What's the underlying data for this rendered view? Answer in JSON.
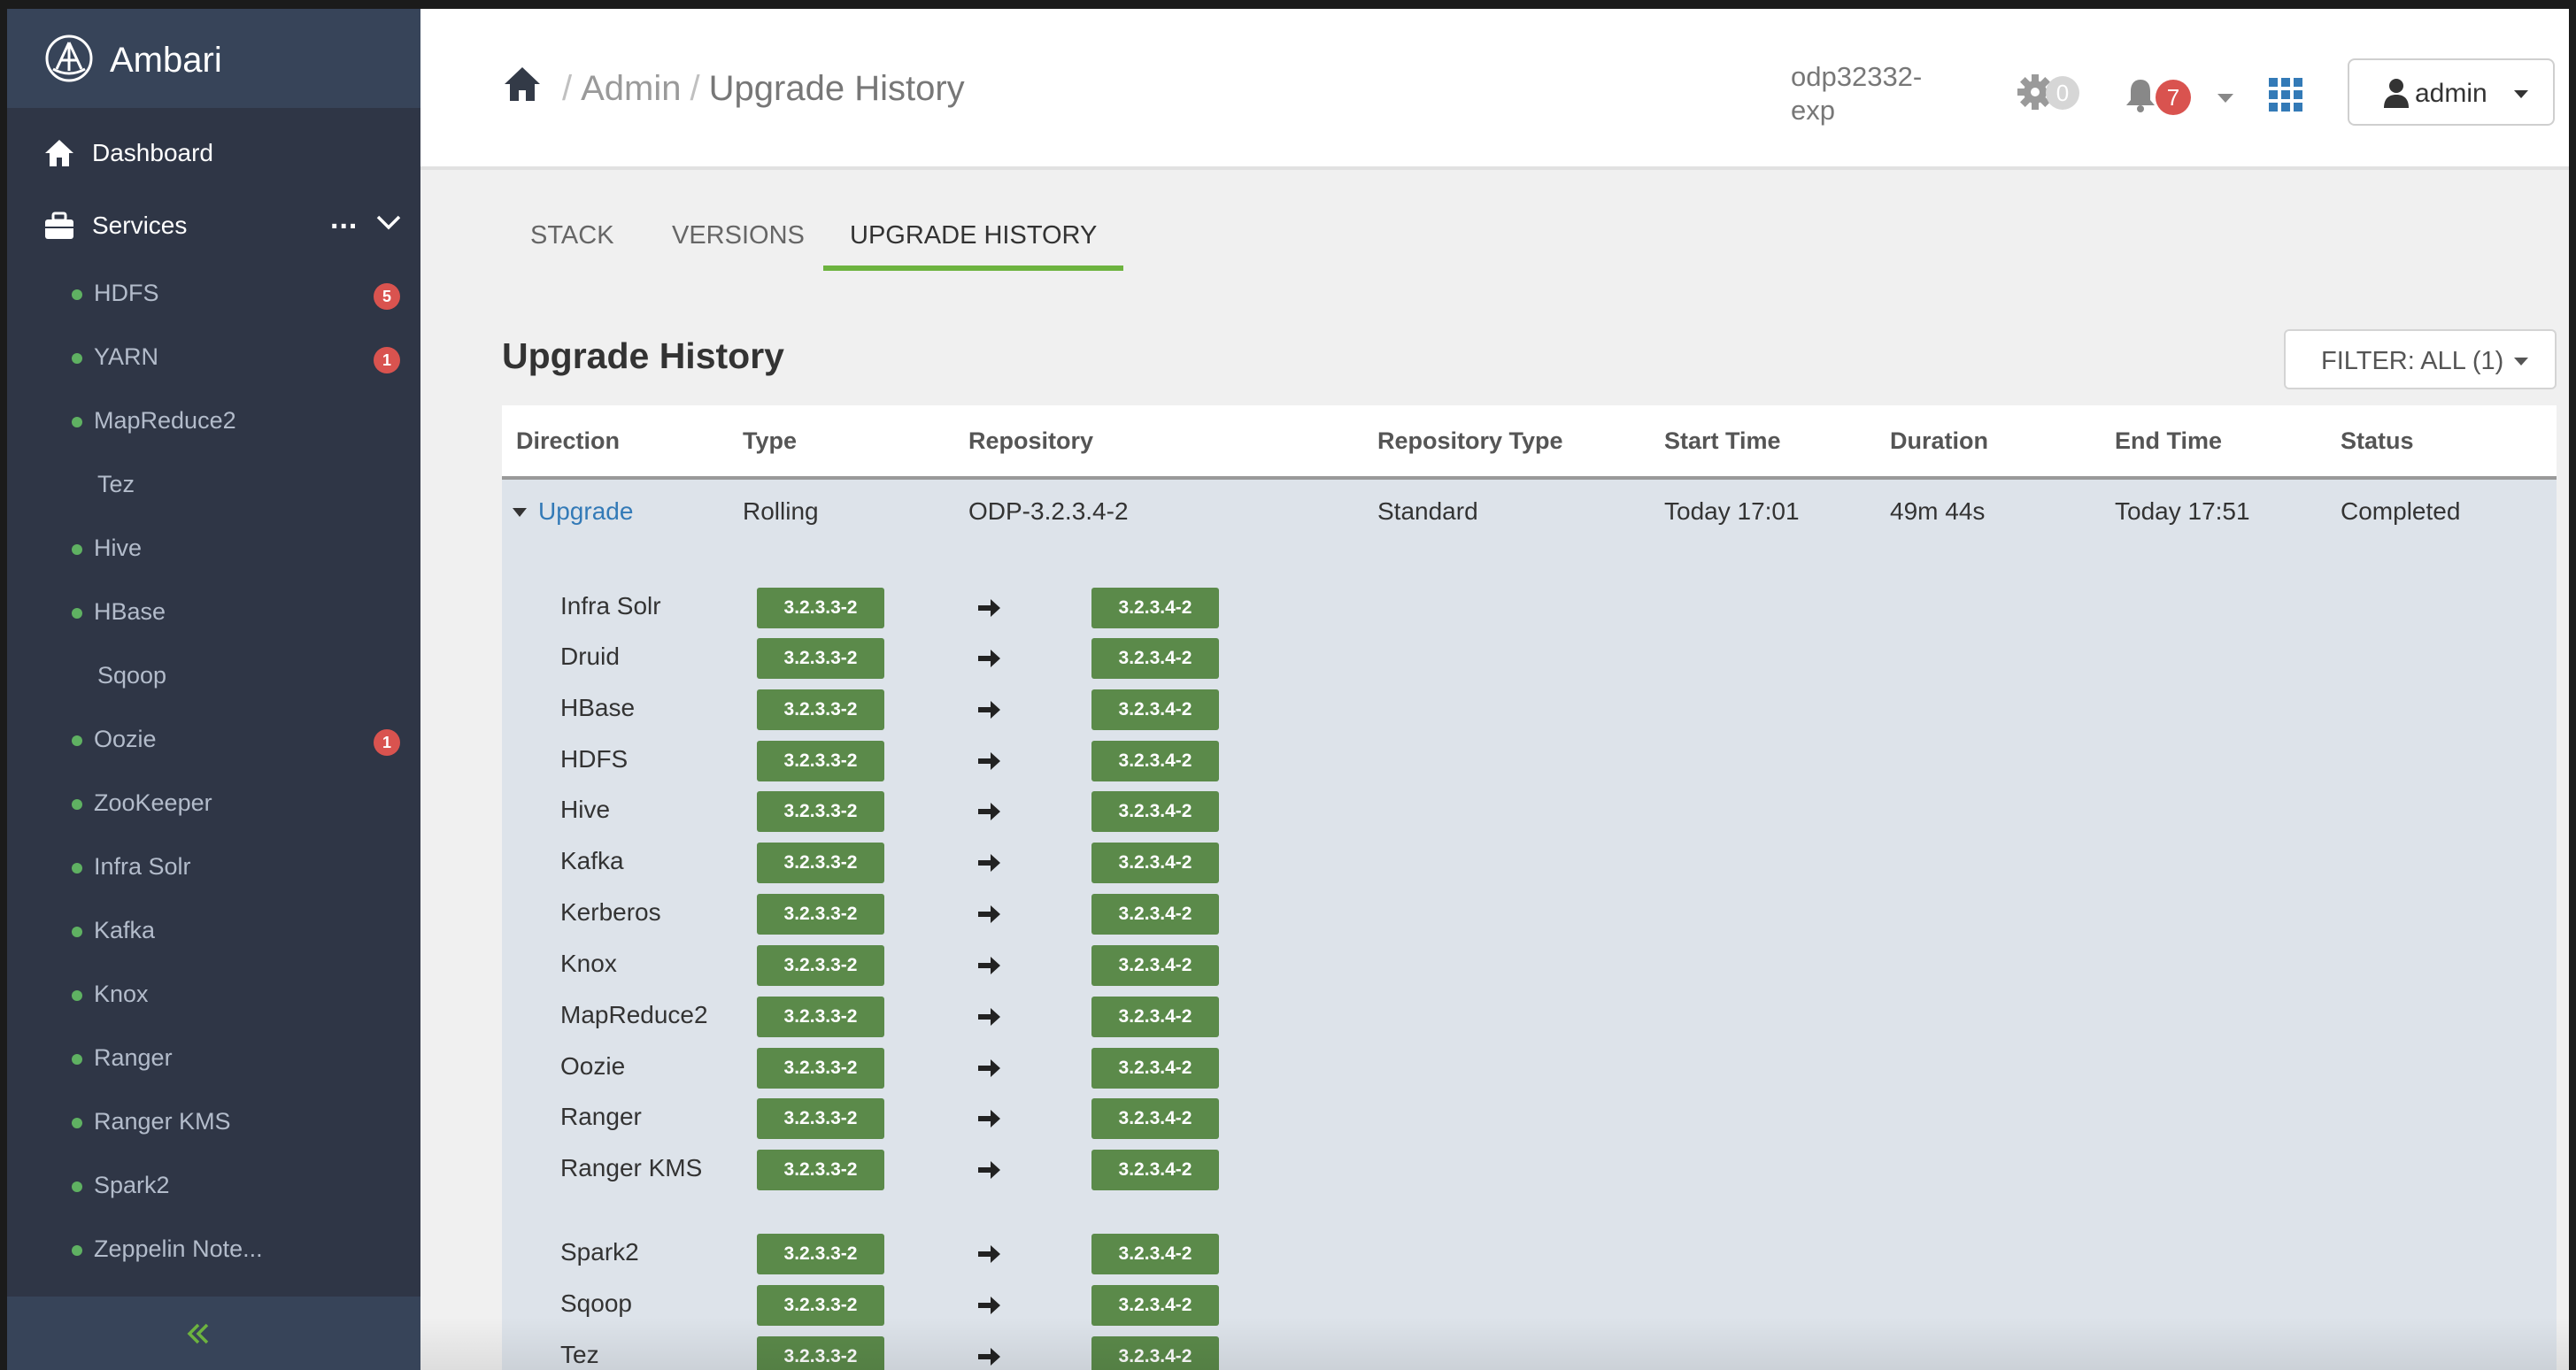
{
  "app": {
    "brand": "Ambari"
  },
  "sidebar": {
    "nav": [
      {
        "label": "Dashboard",
        "icon": "home-icon"
      },
      {
        "label": "Services",
        "icon": "briefcase-icon",
        "more": "..."
      }
    ],
    "services": [
      {
        "label": "HDFS",
        "dot": true,
        "badge": "5"
      },
      {
        "label": "YARN",
        "dot": true,
        "badge": "1"
      },
      {
        "label": "MapReduce2",
        "dot": true,
        "badge": null
      },
      {
        "label": "Tez",
        "dot": false,
        "badge": null
      },
      {
        "label": "Hive",
        "dot": true,
        "badge": null
      },
      {
        "label": "HBase",
        "dot": true,
        "badge": null
      },
      {
        "label": "Sqoop",
        "dot": false,
        "badge": null
      },
      {
        "label": "Oozie",
        "dot": true,
        "badge": "1"
      },
      {
        "label": "ZooKeeper",
        "dot": true,
        "badge": null
      },
      {
        "label": "Infra Solr",
        "dot": true,
        "badge": null
      },
      {
        "label": "Kafka",
        "dot": true,
        "badge": null
      },
      {
        "label": "Knox",
        "dot": true,
        "badge": null
      },
      {
        "label": "Ranger",
        "dot": true,
        "badge": null
      },
      {
        "label": "Ranger KMS",
        "dot": true,
        "badge": null
      },
      {
        "label": "Spark2",
        "dot": true,
        "badge": null
      },
      {
        "label": "Zeppelin Note...",
        "dot": true,
        "badge": null
      }
    ],
    "colors": {
      "background": "#2f3646",
      "header": "#374459",
      "status_ok": "#5fb162",
      "badge": "#d9534f",
      "collapse": "#6db33f"
    }
  },
  "header": {
    "breadcrumb": [
      "Admin",
      "Upgrade History"
    ],
    "cluster_name": "odp32332-exp",
    "ops_count": "0",
    "alerts_count": "7",
    "user": "admin"
  },
  "tabs": [
    {
      "label": "STACK",
      "active": false
    },
    {
      "label": "VERSIONS",
      "active": false
    },
    {
      "label": "UPGRADE HISTORY",
      "active": true
    }
  ],
  "page": {
    "title": "Upgrade History",
    "filter_label": "FILTER: ALL (1)"
  },
  "table": {
    "columns": [
      "Direction",
      "Type",
      "Repository",
      "Repository Type",
      "Start Time",
      "Duration",
      "End Time",
      "Status"
    ],
    "row": {
      "direction": "Upgrade",
      "type": "Rolling",
      "repository": "ODP-3.2.3.4-2",
      "repository_type": "Standard",
      "start_time": "Today 17:01",
      "duration": "49m 44s",
      "end_time": "Today 17:51",
      "status": "Completed"
    },
    "from_version": "3.2.3.3-2",
    "to_version": "3.2.3.4-2",
    "components": [
      "Infra Solr",
      "Druid",
      "HBase",
      "HDFS",
      "Hive",
      "Kafka",
      "Kerberos",
      "Knox",
      "MapReduce2",
      "Oozie",
      "Ranger",
      "Ranger KMS",
      "Spark2",
      "Sqoop",
      "Tez"
    ],
    "colors": {
      "version_badge": "#5b8a4a",
      "link": "#337ab7",
      "tab_active": "#6db33f"
    }
  }
}
